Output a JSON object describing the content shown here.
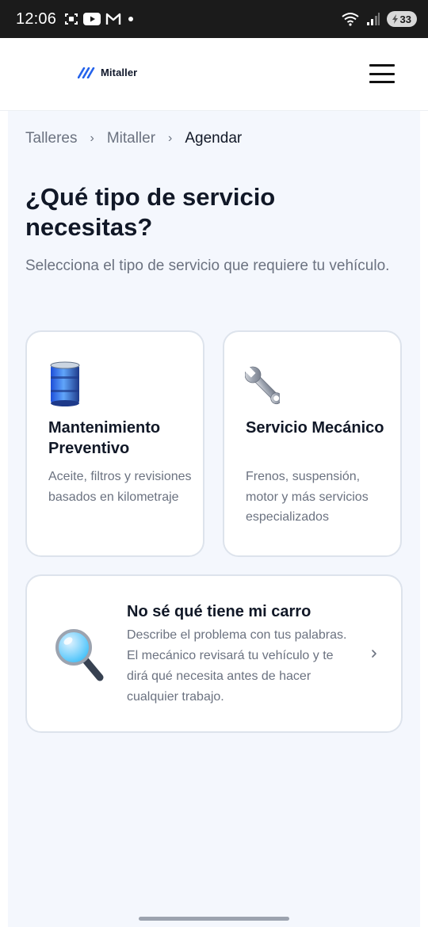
{
  "status_bar": {
    "time": "12:06",
    "battery": "33",
    "icons_left": [
      "screenshot-icon",
      "youtube-icon",
      "gmail-icon",
      "dot-icon"
    ],
    "icons_right": [
      "wifi-icon",
      "signal-icon",
      "battery-icon"
    ]
  },
  "header": {
    "logo_text": "Mitaller",
    "menu_icon": "hamburger-menu-icon"
  },
  "breadcrumb": {
    "items": [
      "Talleres",
      "Mitaller",
      "Agendar"
    ],
    "separator": "›"
  },
  "page": {
    "title": "¿Qué tipo de servicio necesitas?",
    "subtitle": "Selecciona el tipo de servicio que requiere tu vehículo."
  },
  "services": [
    {
      "icon": "oil-drum-icon",
      "title": "Mantenimiento Preventivo",
      "description": "Aceite, filtros y revisiones basados en kilometraje"
    },
    {
      "icon": "wrench-icon",
      "title": "Servicio Mecánico",
      "description": "Frenos, suspensión, motor y más servicios especializados"
    }
  ],
  "diagnostic": {
    "icon": "magnifying-glass-icon",
    "title": "No sé qué tiene mi carro",
    "description": "Describe el problema con tus palabras. El mecánico revisará tu vehículo y te dirá qué necesita antes de hacer cualquier trabajo."
  },
  "colors": {
    "accent": "#2563eb",
    "page_background": "#f4f7fd",
    "card_border": "#dde3ec",
    "text_primary": "#111827",
    "text_secondary": "#6b7280"
  }
}
